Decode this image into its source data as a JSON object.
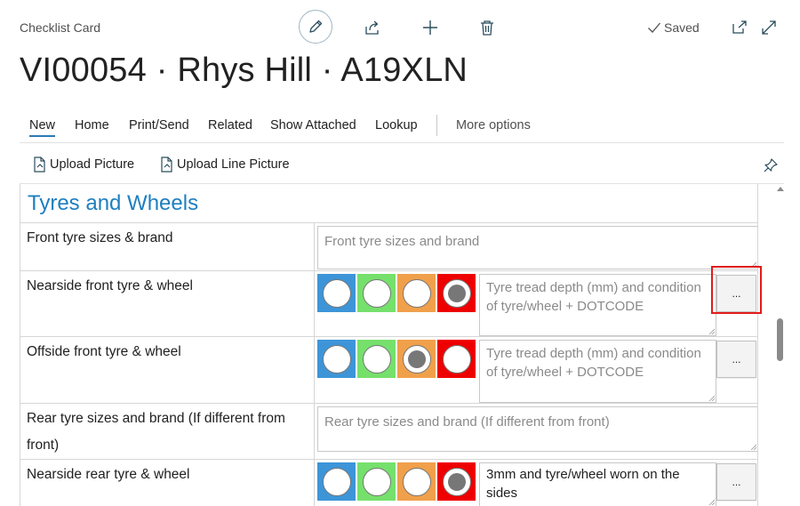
{
  "header": {
    "caption": "Checklist Card",
    "saved_label": "Saved",
    "title": "VI00054 · Rhys Hill · A19XLN"
  },
  "actions": {
    "items": [
      "New",
      "Home",
      "Print/Send",
      "Related",
      "Show Attached",
      "Lookup"
    ],
    "more": "More options",
    "upload_picture": "Upload Picture",
    "upload_line_picture": "Upload Line Picture"
  },
  "group": {
    "title": "Tyres and Wheels",
    "rows": [
      {
        "label": "Front tyre sizes & brand",
        "placeholder": "Front tyre sizes and brand",
        "value": ""
      },
      {
        "label": "Nearside front tyre & wheel",
        "placeholder": "Tyre tread depth (mm) and condition of tyre/wheel + DOTCODE",
        "value": "",
        "selected": "red"
      },
      {
        "label": "Offside front tyre & wheel",
        "placeholder": "Tyre tread depth (mm) and condition of tyre/wheel + DOTCODE",
        "value": "",
        "selected": "orange"
      },
      {
        "label": "Rear tyre sizes and brand (If different from front)",
        "placeholder": "Rear tyre sizes and brand (If different from front)",
        "value": ""
      },
      {
        "label": "Nearside rear tyre & wheel",
        "placeholder": "",
        "value": "3mm and tyre/wheel worn on the sides",
        "selected": "red"
      }
    ],
    "dots_label": "..."
  },
  "colors": {
    "accent": "#2a7ab6",
    "blue": "#3d95d8",
    "green": "#76e06c",
    "orange": "#f0a04b",
    "red": "#ee0000",
    "highlight": "#e21b1b"
  },
  "icons": [
    "edit-icon",
    "share-icon",
    "plus-icon",
    "delete-icon",
    "check-icon",
    "open-in-new-icon",
    "expand-icon",
    "upload-file-icon",
    "pin-icon"
  ]
}
